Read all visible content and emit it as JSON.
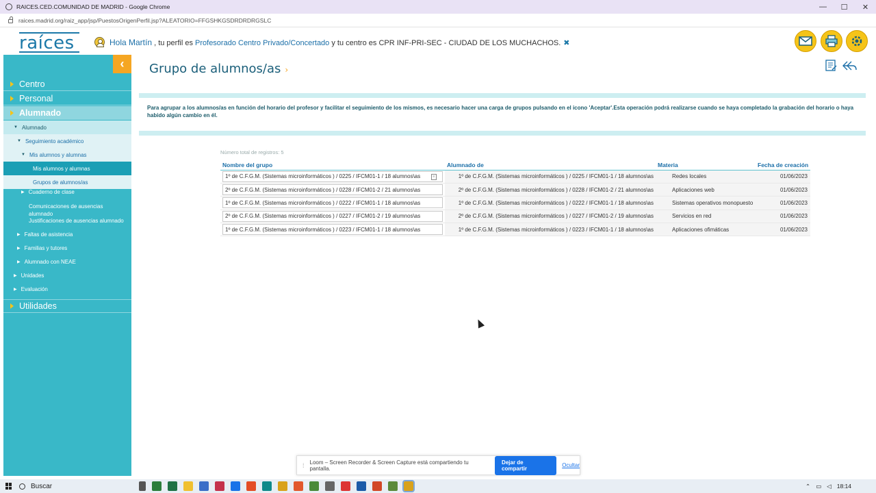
{
  "window": {
    "title": "RAICES.CED.COMUNIDAD DE MADRID - Google Chrome",
    "url": "raices.madrid.org/raiz_app/jsp/PuestosOrigenPerfil.jsp?ALEATORIO=FFGSHKGSDRDRDRGSLC",
    "minimize": "—",
    "maximize": "☐",
    "close": "✕"
  },
  "header": {
    "logo": "raíces",
    "greeting_hola": "Hola Martín",
    "greeting_perfil": " , tu perfil es ",
    "perfil": "Profesorado Centro Privado/Concertado",
    "greeting_centro": " y tu centro es CPR INF-PRI-SEC - CIUDAD DE LOS MUCHACHOS.",
    "close_glyph": "✖",
    "icons": [
      "mail-icon",
      "printer-icon",
      "settings-icon"
    ]
  },
  "sidebar": {
    "collapse_glyph": "‹",
    "items": [
      {
        "label": "Centro"
      },
      {
        "label": "Personal"
      },
      {
        "label": "Alumnado"
      }
    ],
    "sub": {
      "alumnado": "Alumnado",
      "seguimiento": "Seguimiento académico",
      "mis_alumnos": "Mis alumnos y alumnas",
      "mis_alumnos_leaf": "Mis alumnos y alumnas",
      "grupos": "Grupos de alumnos/as",
      "cuaderno": "Cuaderno de clase",
      "comunicaciones_1": "Comunicaciones de ausencias",
      "comunicaciones_2": "alumnado",
      "justificaciones": "Justificaciones de ausencias alumnado",
      "faltas": "Faltas de asistencia",
      "familias": "Familias y tutores",
      "neae": "Alumnado con NEAE",
      "unidades": "Unidades",
      "evaluacion": "Evaluación"
    },
    "utilidades": "Utilidades"
  },
  "main": {
    "title": "Grupo de alumnos/as",
    "chevron": "›",
    "message": "Para agrupar a los alumnos/as en función del horario del profesor y facilitar el seguimiento de los mismos, es necesario hacer una carga de grupos pulsando en el icono 'Aceptar'.Esta operación podrá realizarse cuando se haya completado la grabación del horario o haya habido algún cambio en él.",
    "record_count": "Número total de registros: 5",
    "table": {
      "headers": [
        "Nombre del grupo",
        "Alumnado de",
        "Materia",
        "Fecha de creación"
      ],
      "rows": [
        {
          "nombre": "1º de C.F.G.M. (Sistemas microinformáticos ) / 0225 / IFCM01-1 / 18 alumnos\\as",
          "alumnado": "1º de C.F.G.M. (Sistemas microinformáticos ) / 0225 / IFCM01-1 / 18 alumnos\\as",
          "materia": "Redes locales",
          "fecha": "01/06/2023"
        },
        {
          "nombre": "2º de C.F.G.M. (Sistemas microinformáticos ) / 0228 / IFCM01-2 / 21 alumnos\\as",
          "alumnado": "2º de C.F.G.M. (Sistemas microinformáticos ) / 0228 / IFCM01-2 / 21 alumnos\\as",
          "materia": "Aplicaciones web",
          "fecha": "01/06/2023"
        },
        {
          "nombre": "1º de C.F.G.M. (Sistemas microinformáticos ) / 0222 / IFCM01-1 / 18 alumnos\\as",
          "alumnado": "1º de C.F.G.M. (Sistemas microinformáticos ) / 0222 / IFCM01-1 / 18 alumnos\\as",
          "materia": "Sistemas operativos monopuesto",
          "fecha": "01/06/2023"
        },
        {
          "nombre": "2º de C.F.G.M. (Sistemas microinformáticos ) / 0227 / IFCM01-2 / 19 alumnos\\as",
          "alumnado": "2º de C.F.G.M. (Sistemas microinformáticos ) / 0227 / IFCM01-2 / 19 alumnos\\as",
          "materia": "Servicios en red",
          "fecha": "01/06/2023"
        },
        {
          "nombre": "1º de C.F.G.M. (Sistemas microinformáticos ) / 0223 / IFCM01-1 / 18 alumnos\\as",
          "alumnado": "1º de C.F.G.M. (Sistemas microinformáticos ) / 0223 / IFCM01-1 / 18 alumnos\\as",
          "materia": "Aplicaciones ofimáticas",
          "fecha": "01/06/2023"
        }
      ]
    }
  },
  "loom": {
    "grip": "⁞",
    "message": "Loom – Screen Recorder & Screen Capture está compartiendo tu pantalla.",
    "stop_button": "Dejar de compartir",
    "hide_link": "Ocultar"
  },
  "taskbar": {
    "search_placeholder": "Buscar",
    "clock": "18:14"
  },
  "colors": {
    "sidebar": "#39b8c8",
    "accent": "#f5a623",
    "link": "#1b6fa8"
  }
}
